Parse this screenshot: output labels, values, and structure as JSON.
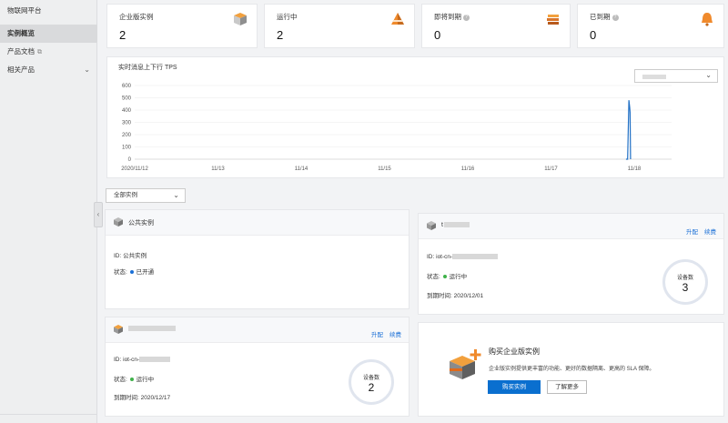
{
  "sidebar": {
    "title": "物联网平台",
    "items": [
      {
        "label": "实例概览",
        "active": true
      },
      {
        "label": "产品文档"
      },
      {
        "label": "相关产品"
      }
    ]
  },
  "stats": [
    {
      "label": "企业版实例",
      "value": "2",
      "icon": "box-stack-icon"
    },
    {
      "label": "运行中",
      "value": "2",
      "icon": "orange-pyramid-icon"
    },
    {
      "label": "即将到期",
      "value": "0",
      "icon": "books-stack-icon"
    },
    {
      "label": "已到期",
      "value": "0",
      "icon": "bell-icon"
    }
  ],
  "chart_data": {
    "type": "line",
    "title": "实时消息上下行 TPS",
    "y_ticks": [
      "600",
      "500",
      "400",
      "300",
      "200",
      "100",
      "0"
    ],
    "ylim": [
      0,
      600
    ],
    "x_ticks": [
      "2020/11/12",
      "11/13",
      "11/14",
      "11/15",
      "11/16",
      "11/17",
      "11/18"
    ],
    "series": [
      {
        "values": [
          [
            5.9,
            0
          ],
          [
            5.92,
            0
          ],
          [
            5.935,
            480
          ],
          [
            5.945,
            420
          ],
          [
            5.95,
            380
          ],
          [
            5.955,
            0
          ]
        ],
        "color": "#1f6fc5"
      }
    ],
    "grid": true
  },
  "filter": {
    "label": "全部实例"
  },
  "public_instance": {
    "name": "公共实例",
    "id_label": "ID:",
    "id_value": "公共实例",
    "status_label": "状态:",
    "status": "已开通",
    "status_color": "#1a6fd6"
  },
  "instances": [
    {
      "name_prefix": "t",
      "actions": [
        "升配",
        "续费"
      ],
      "id_label": "ID:",
      "id_prefix": "iot-cn-",
      "status_label": "状态:",
      "status": "运行中",
      "status_color": "#3fb24a",
      "expire_label": "到期时间:",
      "expire": "2020/12/01",
      "device_label": "设备数",
      "device_count": "3"
    },
    {
      "name_prefix": "",
      "actions": [
        "升配",
        "续费"
      ],
      "id_label": "ID:",
      "id_prefix": "iot-cn-",
      "status_label": "状态:",
      "status": "运行中",
      "status_color": "#3fb24a",
      "expire_label": "到期时间:",
      "expire": "2020/12/17",
      "device_label": "设备数",
      "device_count": "2"
    }
  ],
  "promo": {
    "title": "购买企业版实例",
    "desc": "企业版实例提供更丰富的功能、更好的数据隔离、更高的 SLA 保障。",
    "buy_label": "购买实例",
    "learn_label": "了解更多"
  }
}
